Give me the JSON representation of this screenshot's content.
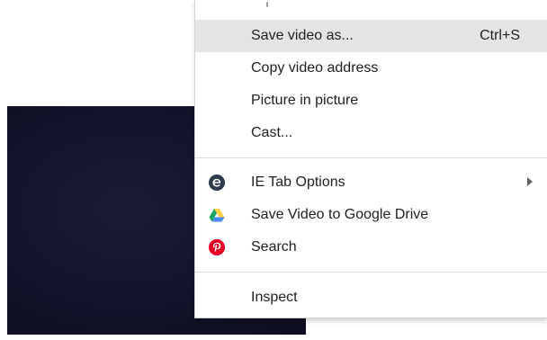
{
  "context_menu": {
    "items": [
      {
        "label": "Save video as...",
        "shortcut": "Ctrl+S",
        "highlighted": true
      },
      {
        "label": "Copy video address"
      },
      {
        "label": "Picture in picture"
      },
      {
        "label": "Cast..."
      },
      {
        "label": "IE Tab Options",
        "icon": "ie-tab-icon",
        "submenu": true
      },
      {
        "label": "Save Video to Google Drive",
        "icon": "google-drive-icon"
      },
      {
        "label": "Search",
        "icon": "pinterest-icon"
      },
      {
        "label": "Inspect"
      }
    ]
  },
  "colors": {
    "highlight": "#e4e4e4",
    "ie_tab_icon": "#2e3b4e",
    "pinterest": "#e60023",
    "drive_green": "#1fa463",
    "drive_yellow": "#ffd04b",
    "drive_blue": "#4688f4",
    "video_background": "#121228"
  }
}
